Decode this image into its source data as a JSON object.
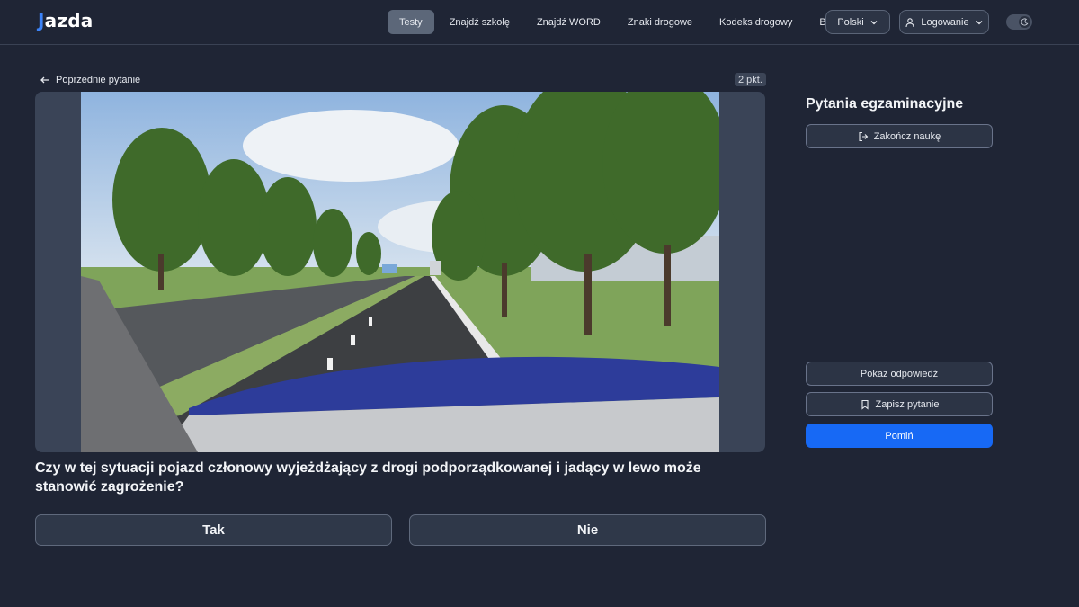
{
  "header": {
    "logo_mark": "J",
    "logo_text": "azda",
    "nav": [
      "Testy",
      "Znajdź szkołę",
      "Znajdź WORD",
      "Znaki drogowe",
      "Kodeks drogowy",
      "Blog"
    ],
    "language": "Polski",
    "login": "Logowanie"
  },
  "quiz": {
    "back_label": "Poprzednie pytanie",
    "points": "2 pkt.",
    "question": "Czy w tej sytuacji pojazd członowy wyjeżdżający z drogi podporządkowanej i jadący w lewo może stanowić zagrożenie?",
    "answers": [
      "Tak",
      "Nie"
    ]
  },
  "panel": {
    "title": "Pytania egzaminacyjne",
    "end_label": "Zakończ naukę",
    "show_label": "Pokaż odpowiedź",
    "save_label": "Zapisz pytanie",
    "skip_label": "Pomiń"
  },
  "colors": {
    "background": "#1f2535",
    "accent": "#1769f5",
    "logo_accent": "#3b82f6"
  }
}
